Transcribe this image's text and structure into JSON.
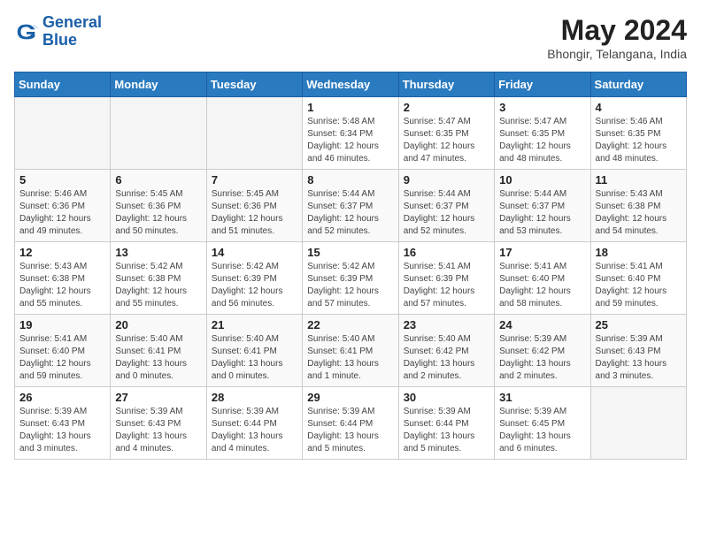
{
  "header": {
    "logo_line1": "General",
    "logo_line2": "Blue",
    "month": "May 2024",
    "location": "Bhongir, Telangana, India"
  },
  "weekdays": [
    "Sunday",
    "Monday",
    "Tuesday",
    "Wednesday",
    "Thursday",
    "Friday",
    "Saturday"
  ],
  "weeks": [
    [
      {
        "day": "",
        "info": ""
      },
      {
        "day": "",
        "info": ""
      },
      {
        "day": "",
        "info": ""
      },
      {
        "day": "1",
        "info": "Sunrise: 5:48 AM\nSunset: 6:34 PM\nDaylight: 12 hours\nand 46 minutes."
      },
      {
        "day": "2",
        "info": "Sunrise: 5:47 AM\nSunset: 6:35 PM\nDaylight: 12 hours\nand 47 minutes."
      },
      {
        "day": "3",
        "info": "Sunrise: 5:47 AM\nSunset: 6:35 PM\nDaylight: 12 hours\nand 48 minutes."
      },
      {
        "day": "4",
        "info": "Sunrise: 5:46 AM\nSunset: 6:35 PM\nDaylight: 12 hours\nand 48 minutes."
      }
    ],
    [
      {
        "day": "5",
        "info": "Sunrise: 5:46 AM\nSunset: 6:36 PM\nDaylight: 12 hours\nand 49 minutes."
      },
      {
        "day": "6",
        "info": "Sunrise: 5:45 AM\nSunset: 6:36 PM\nDaylight: 12 hours\nand 50 minutes."
      },
      {
        "day": "7",
        "info": "Sunrise: 5:45 AM\nSunset: 6:36 PM\nDaylight: 12 hours\nand 51 minutes."
      },
      {
        "day": "8",
        "info": "Sunrise: 5:44 AM\nSunset: 6:37 PM\nDaylight: 12 hours\nand 52 minutes."
      },
      {
        "day": "9",
        "info": "Sunrise: 5:44 AM\nSunset: 6:37 PM\nDaylight: 12 hours\nand 52 minutes."
      },
      {
        "day": "10",
        "info": "Sunrise: 5:44 AM\nSunset: 6:37 PM\nDaylight: 12 hours\nand 53 minutes."
      },
      {
        "day": "11",
        "info": "Sunrise: 5:43 AM\nSunset: 6:38 PM\nDaylight: 12 hours\nand 54 minutes."
      }
    ],
    [
      {
        "day": "12",
        "info": "Sunrise: 5:43 AM\nSunset: 6:38 PM\nDaylight: 12 hours\nand 55 minutes."
      },
      {
        "day": "13",
        "info": "Sunrise: 5:42 AM\nSunset: 6:38 PM\nDaylight: 12 hours\nand 55 minutes."
      },
      {
        "day": "14",
        "info": "Sunrise: 5:42 AM\nSunset: 6:39 PM\nDaylight: 12 hours\nand 56 minutes."
      },
      {
        "day": "15",
        "info": "Sunrise: 5:42 AM\nSunset: 6:39 PM\nDaylight: 12 hours\nand 57 minutes."
      },
      {
        "day": "16",
        "info": "Sunrise: 5:41 AM\nSunset: 6:39 PM\nDaylight: 12 hours\nand 57 minutes."
      },
      {
        "day": "17",
        "info": "Sunrise: 5:41 AM\nSunset: 6:40 PM\nDaylight: 12 hours\nand 58 minutes."
      },
      {
        "day": "18",
        "info": "Sunrise: 5:41 AM\nSunset: 6:40 PM\nDaylight: 12 hours\nand 59 minutes."
      }
    ],
    [
      {
        "day": "19",
        "info": "Sunrise: 5:41 AM\nSunset: 6:40 PM\nDaylight: 12 hours\nand 59 minutes."
      },
      {
        "day": "20",
        "info": "Sunrise: 5:40 AM\nSunset: 6:41 PM\nDaylight: 13 hours\nand 0 minutes."
      },
      {
        "day": "21",
        "info": "Sunrise: 5:40 AM\nSunset: 6:41 PM\nDaylight: 13 hours\nand 0 minutes."
      },
      {
        "day": "22",
        "info": "Sunrise: 5:40 AM\nSunset: 6:41 PM\nDaylight: 13 hours\nand 1 minute."
      },
      {
        "day": "23",
        "info": "Sunrise: 5:40 AM\nSunset: 6:42 PM\nDaylight: 13 hours\nand 2 minutes."
      },
      {
        "day": "24",
        "info": "Sunrise: 5:39 AM\nSunset: 6:42 PM\nDaylight: 13 hours\nand 2 minutes."
      },
      {
        "day": "25",
        "info": "Sunrise: 5:39 AM\nSunset: 6:43 PM\nDaylight: 13 hours\nand 3 minutes."
      }
    ],
    [
      {
        "day": "26",
        "info": "Sunrise: 5:39 AM\nSunset: 6:43 PM\nDaylight: 13 hours\nand 3 minutes."
      },
      {
        "day": "27",
        "info": "Sunrise: 5:39 AM\nSunset: 6:43 PM\nDaylight: 13 hours\nand 4 minutes."
      },
      {
        "day": "28",
        "info": "Sunrise: 5:39 AM\nSunset: 6:44 PM\nDaylight: 13 hours\nand 4 minutes."
      },
      {
        "day": "29",
        "info": "Sunrise: 5:39 AM\nSunset: 6:44 PM\nDaylight: 13 hours\nand 5 minutes."
      },
      {
        "day": "30",
        "info": "Sunrise: 5:39 AM\nSunset: 6:44 PM\nDaylight: 13 hours\nand 5 minutes."
      },
      {
        "day": "31",
        "info": "Sunrise: 5:39 AM\nSunset: 6:45 PM\nDaylight: 13 hours\nand 6 minutes."
      },
      {
        "day": "",
        "info": ""
      }
    ]
  ]
}
